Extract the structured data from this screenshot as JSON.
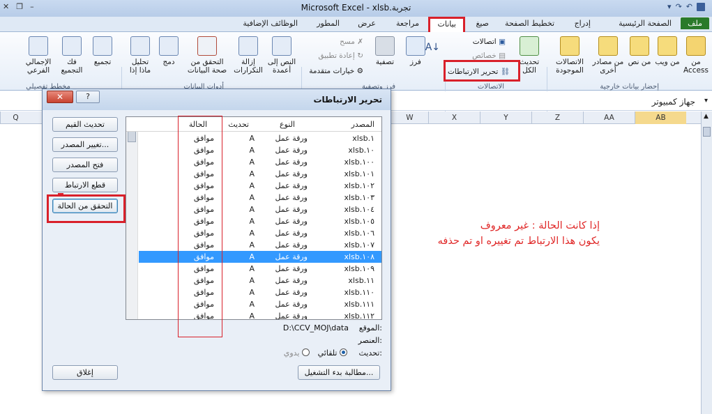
{
  "window": {
    "title": "Microsoft Excel - xlsb.تجربة"
  },
  "tabs": [
    {
      "label": "ملف"
    },
    {
      "label": "الصفحة الرئيسية"
    },
    {
      "label": "إدراج"
    },
    {
      "label": "تخطيط الصفحة"
    },
    {
      "label": "صيغ"
    },
    {
      "label": "بيانات"
    },
    {
      "label": "مراجعة"
    },
    {
      "label": "عرض"
    },
    {
      "label": "المطور"
    },
    {
      "label": "الوظائف الإضافية"
    }
  ],
  "ribbon": {
    "ext_data": {
      "access": "من Access",
      "web": "من ويب",
      "text": "من نص",
      "other": "من مصادر أخرى",
      "existing": "الاتصالات الموجودة",
      "group": "إحضار بيانات خارجية"
    },
    "connections": {
      "refresh_all": "تحديث الكل",
      "connections": "اتصالات",
      "properties": "خصائص",
      "edit_links": "تحرير الارتباطات",
      "group": "الاتصالات"
    },
    "sort_filter": {
      "sort": "فرز",
      "filter": "تصفية",
      "clear": "مسح",
      "reapply": "إعادة تطبيق",
      "advanced": "خيارات متقدمة",
      "group": "فرز وتصفية"
    },
    "data_tools": {
      "text_to_cols": "النص إلى أعمدة",
      "remove_dup": "إزالة التكرارات",
      "validation": "التحقق من صحة البيانات",
      "consolidate": "دمج",
      "whatif": "تحليل ماذا إذا",
      "group": "أدوات البيانات"
    },
    "outline": {
      "group_btn": "تجميع",
      "ungroup": "فك التجميع",
      "subtotal": "الإجمالي الفرعي",
      "group": "مخطط تفصيلي"
    }
  },
  "formula_bar": {
    "value": "جهاز كمبيوتر"
  },
  "columns": [
    "AB",
    "AA",
    "Z",
    "Y",
    "X",
    "W",
    "Q"
  ],
  "dialog": {
    "title": "تحرير الارتباطات",
    "headers": {
      "source": "المصدر",
      "type": "النوع",
      "update": "تحديث",
      "status": "الحالة"
    },
    "rows": [
      {
        "source": "xlsb.١",
        "type": "ورقة عمل",
        "update": "A",
        "status": "موافق"
      },
      {
        "source": "xlsb.١٠",
        "type": "ورقة عمل",
        "update": "A",
        "status": "موافق"
      },
      {
        "source": "xlsb.١٠٠",
        "type": "ورقة عمل",
        "update": "A",
        "status": "موافق"
      },
      {
        "source": "xlsb.١٠١",
        "type": "ورقة عمل",
        "update": "A",
        "status": "موافق"
      },
      {
        "source": "xlsb.١٠٢",
        "type": "ورقة عمل",
        "update": "A",
        "status": "موافق"
      },
      {
        "source": "xlsb.١٠٣",
        "type": "ورقة عمل",
        "update": "A",
        "status": "موافق"
      },
      {
        "source": "xlsb.١٠٤",
        "type": "ورقة عمل",
        "update": "A",
        "status": "موافق"
      },
      {
        "source": "xlsb.١٠٥",
        "type": "ورقة عمل",
        "update": "A",
        "status": "موافق"
      },
      {
        "source": "xlsb.١٠٦",
        "type": "ورقة عمل",
        "update": "A",
        "status": "موافق"
      },
      {
        "source": "xlsb.١٠٧",
        "type": "ورقة عمل",
        "update": "A",
        "status": "موافق"
      },
      {
        "source": "xlsb.١٠٨",
        "type": "ورقة عمل",
        "update": "A",
        "status": "موافق"
      },
      {
        "source": "xlsb.١٠٩",
        "type": "ورقة عمل",
        "update": "A",
        "status": "موافق"
      },
      {
        "source": "xlsb.١١",
        "type": "ورقة عمل",
        "update": "A",
        "status": "موافق"
      },
      {
        "source": "xlsb.١١٠",
        "type": "ورقة عمل",
        "update": "A",
        "status": "موافق"
      },
      {
        "source": "xlsb.١١١",
        "type": "ورقة عمل",
        "update": "A",
        "status": "موافق"
      },
      {
        "source": "xlsb.١١٢",
        "type": "ورقة عمل",
        "update": "A",
        "status": "موافق"
      }
    ],
    "buttons": {
      "update_values": "تحديث القيم",
      "change_source": "تغيير المصدر...",
      "open_source": "فتح المصدر",
      "break_link": "قطع الارتباط",
      "check_status": "التحقق من الحالة",
      "startup_prompt": "مطالبة بدء التشغيل...",
      "close": "إغلاق"
    },
    "location_label": "الموقع:",
    "location_value": "D:\\CCV_MOJ\\data",
    "item_label": "العنصر:",
    "update_label": "تحديث:",
    "auto_label": "تلقائي",
    "manual_label": "يدوي"
  },
  "annotation": {
    "line1": "إذا كانت الحالة : غير معروف",
    "line2": "يكون هذا الارتباط تم تغييره او تم حذفه"
  },
  "accent": "#d9202a"
}
